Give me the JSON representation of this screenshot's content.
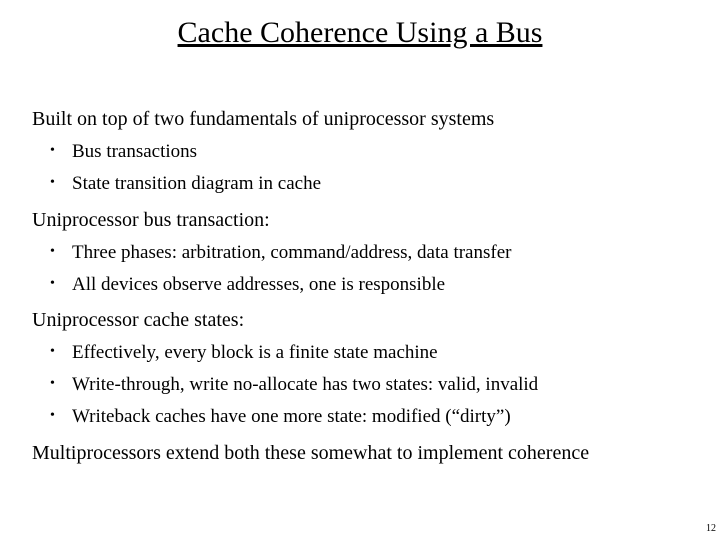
{
  "title": "Cache Coherence Using a Bus",
  "sections": [
    {
      "heading": "Built on top of two fundamentals of uniprocessor systems",
      "bullets": [
        "Bus transactions",
        "State transition diagram in cache"
      ]
    },
    {
      "heading": "Uniprocessor bus transaction:",
      "bullets": [
        "Three phases: arbitration, command/address, data transfer",
        "All devices observe addresses, one is responsible"
      ]
    },
    {
      "heading": "Uniprocessor cache states:",
      "bullets": [
        "Effectively, every block is a finite state machine",
        "Write-through, write no-allocate has two states: valid, invalid",
        "Writeback caches have one more state: modified (“dirty”)"
      ]
    }
  ],
  "closing": "Multiprocessors extend both these somewhat to implement coherence",
  "page_number": "12"
}
